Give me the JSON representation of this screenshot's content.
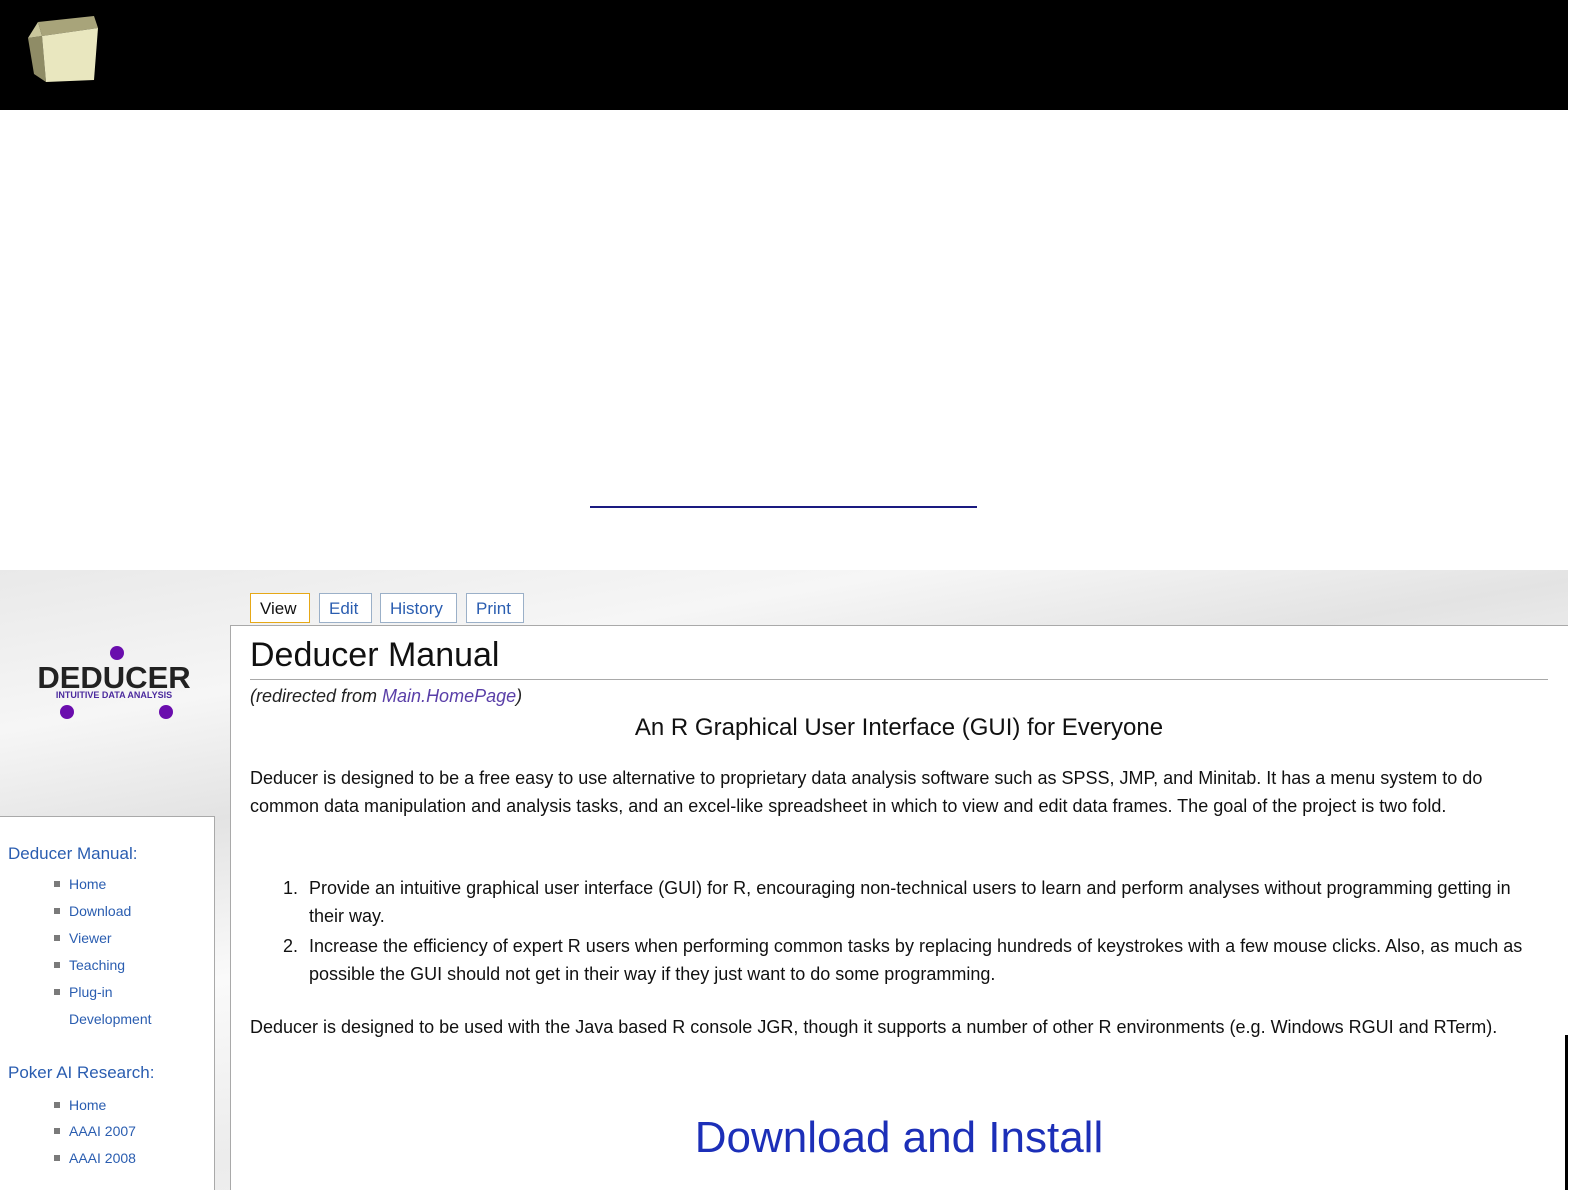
{
  "screenshot": {
    "brand": {
      "name": "DEDUCER",
      "tagline": "INTUITIVE DATA ANALYSIS"
    },
    "tabs": [
      {
        "label": "View",
        "active": true
      },
      {
        "label": "Edit",
        "active": false
      },
      {
        "label": "History",
        "active": false
      },
      {
        "label": "Print",
        "active": false
      }
    ],
    "sidebar": {
      "sections": [
        {
          "title": "Deducer Manual:",
          "items": [
            "Home",
            "Download",
            "Viewer",
            "Teaching",
            "Plug-in",
            "Development"
          ]
        },
        {
          "title": "Poker AI Research:",
          "items": [
            "Home",
            "AAAI 2007",
            "AAAI 2008"
          ]
        }
      ]
    },
    "page": {
      "title": "Deducer Manual",
      "redirect_prefix": "(redirected from ",
      "redirect_link": "Main.HomePage",
      "redirect_suffix": ")",
      "subtitle": "An R Graphical User Interface (GUI) for Everyone",
      "intro": "Deducer is designed to be a free easy to use alternative to proprietary data analysis software such as SPSS, JMP, and Minitab. It has a menu system to do common data manipulation and analysis tasks, and an excel-like spreadsheet in which to view and edit data frames. The goal of the project is two fold.",
      "list": [
        {
          "num": "1.",
          "text": "Provide an intuitive graphical user interface (GUI) for R, encouraging non-technical users to learn and perform analyses without programming getting in their way."
        },
        {
          "num": "2.",
          "text": "Increase the efficiency of expert R users when performing common tasks by replacing hundreds of keystrokes with a few mouse clicks. Also, as much as possible the GUI should not get in their way if they just want to do some programming."
        }
      ],
      "outro": "Deducer is designed to be used with the Java based R console JGR, though it supports a number of other R environments (e.g. Windows RGUI and RTerm).",
      "download_heading": "Download and Install"
    }
  },
  "colors": {
    "topbar": "#000000",
    "link": "#2a5db0",
    "active_tab_border": "#e6a817",
    "heading_blue": "#1c2fb8",
    "brand_purple": "#6a0dad"
  }
}
